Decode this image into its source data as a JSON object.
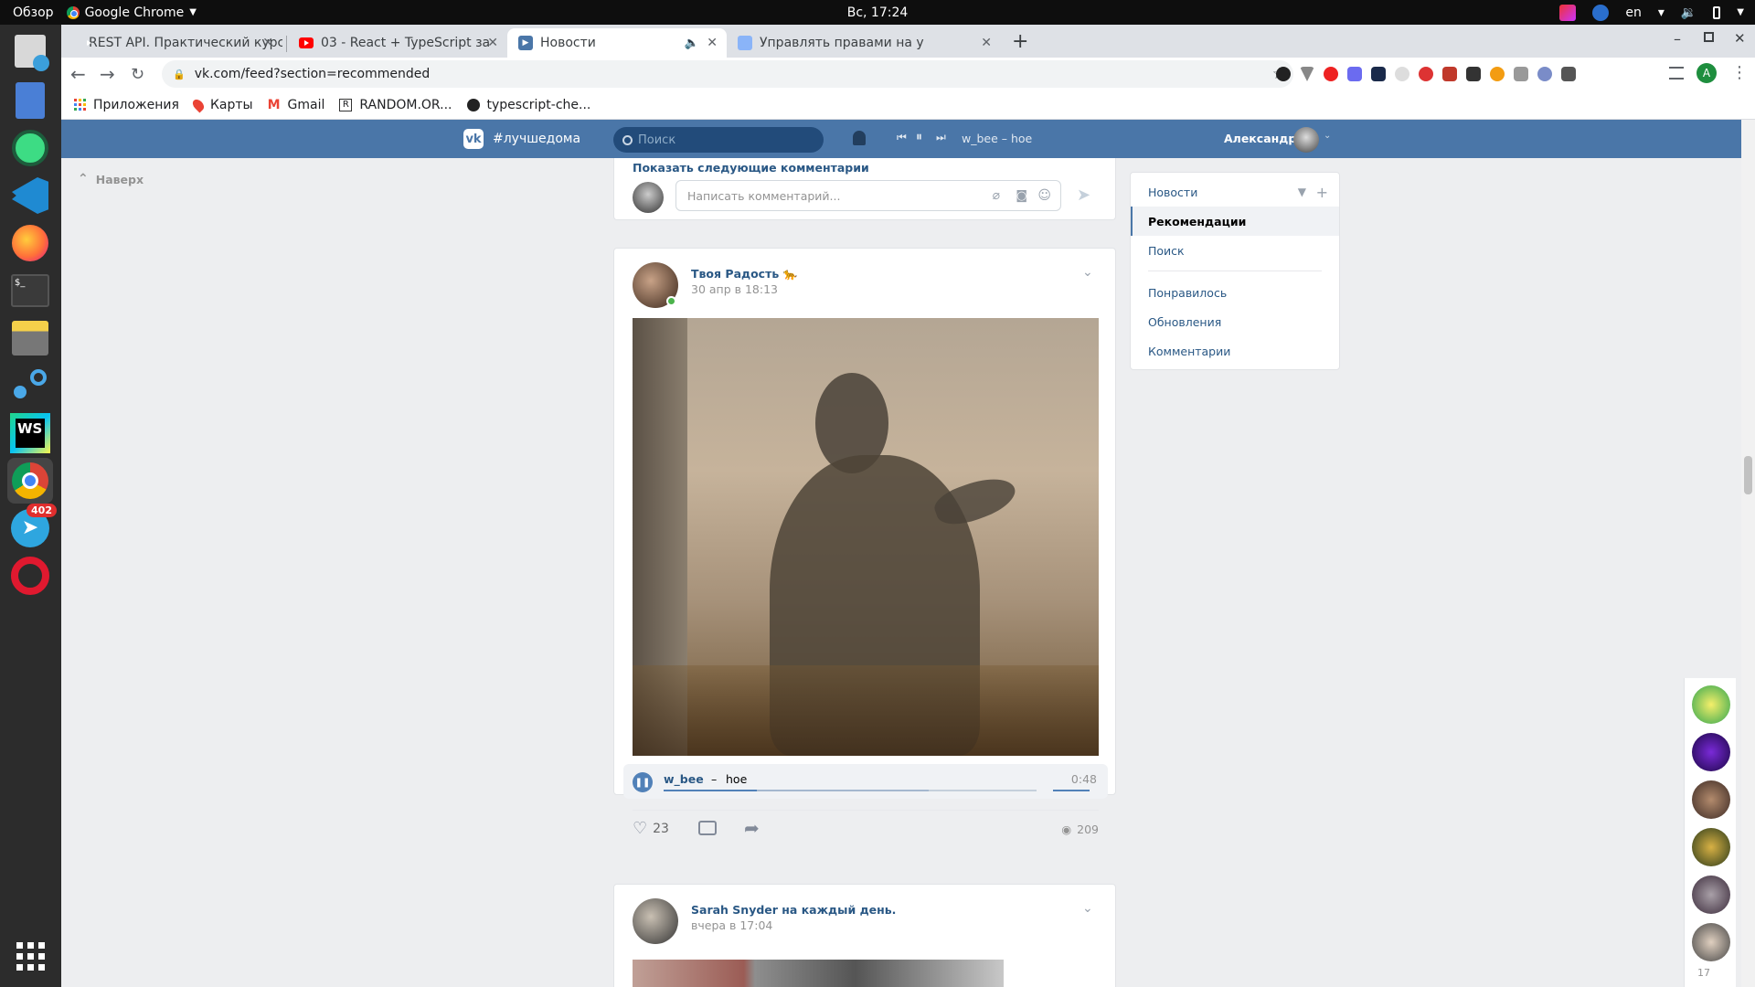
{
  "topbar": {
    "activities": "Обзор",
    "app_name": "Google Chrome",
    "clock": "Вс, 17:24",
    "keyboard_layout": "en"
  },
  "dock": {
    "telegram_badge": "402"
  },
  "chrome": {
    "tabs": [
      {
        "title": "REST API. Практический курс"
      },
      {
        "title": "03 - React + TypeScript за"
      },
      {
        "title": "Новости"
      },
      {
        "title": "Управлять правами на у"
      }
    ],
    "url": "vk.com/feed?section=recommended",
    "profile_initial": "A",
    "bookmarks": [
      {
        "label": "Приложения"
      },
      {
        "label": "Карты"
      },
      {
        "label": "Gmail"
      },
      {
        "label": "RANDOM.OR..."
      },
      {
        "label": "typescript-che..."
      }
    ]
  },
  "vk": {
    "brand": "#лучшедома",
    "search_placeholder": "Поиск",
    "player_track": "w_bee – hoe",
    "user_name": "Александр",
    "back_to_top": "Наверх",
    "show_more_comments": "Показать следующие комментарии",
    "comment_placeholder": "Написать комментарий...",
    "posts": [
      {
        "author": "Твоя Радость 🐆",
        "date": "30 апр в 18:13",
        "audio_artist": "w_bee",
        "audio_sep": "–",
        "audio_title": "hoe",
        "audio_duration": "0:48",
        "audio_progress": 0.25,
        "likes": "23",
        "views": "209"
      },
      {
        "author": "Sarah Snyder на каждый день.",
        "date": "вчера в 17:04"
      }
    ],
    "menu": {
      "items": [
        "Новости",
        "Рекомендации",
        "Поиск",
        "Понравилось",
        "Обновления",
        "Комментарии"
      ]
    },
    "online_count": "17"
  }
}
